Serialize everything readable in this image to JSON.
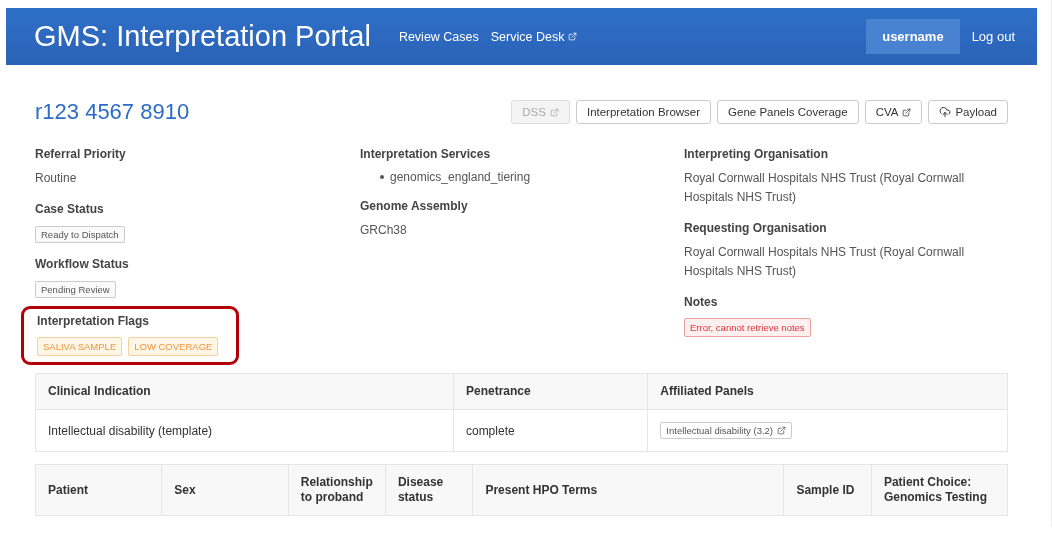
{
  "header": {
    "title": "GMS: Interpretation Portal",
    "nav": [
      {
        "label": "Review Cases",
        "external": false
      },
      {
        "label": "Service Desk",
        "external": true
      }
    ],
    "user": "username",
    "logout": "Log out"
  },
  "case": {
    "id": "r123 4567 8910",
    "actions": [
      {
        "label": "DSS",
        "external": true,
        "disabled": true,
        "kind": "link"
      },
      {
        "label": "Interpretation Browser",
        "external": false,
        "disabled": false,
        "kind": "link"
      },
      {
        "label": "Gene Panels Coverage",
        "external": false,
        "disabled": false,
        "kind": "link"
      },
      {
        "label": "CVA",
        "external": true,
        "disabled": false,
        "kind": "link"
      },
      {
        "label": "Payload",
        "external": false,
        "disabled": false,
        "kind": "upload"
      }
    ]
  },
  "details": [
    [
      {
        "label": "Referral Priority",
        "kind": "text",
        "value": "Routine"
      },
      {
        "label": "Case Status",
        "kind": "tag",
        "value": "Ready to Dispatch"
      },
      {
        "label": "Workflow Status",
        "kind": "tag",
        "value": "Pending Review"
      },
      {
        "label": "Interpretation Flags",
        "kind": "flags",
        "highlighted": true,
        "values": [
          "SALIVA SAMPLE",
          "LOW COVERAGE"
        ]
      }
    ],
    [
      {
        "label": "Interpretation Services",
        "kind": "list",
        "values": [
          "genomics_england_tiering"
        ]
      },
      {
        "label": "Genome Assembly",
        "kind": "text",
        "value": "GRCh38"
      }
    ],
    [
      {
        "label": "Interpreting Organisation",
        "kind": "text",
        "value": "Royal Cornwall Hospitals NHS Trust (Royal Cornwall Hospitals NHS Trust)"
      },
      {
        "label": "Requesting Organisation",
        "kind": "text",
        "value": "Royal Cornwall Hospitals NHS Trust (Royal Cornwall Hospitals NHS Trust)"
      },
      {
        "label": "Notes",
        "kind": "error",
        "value": "Error, cannot retrieve notes"
      }
    ]
  ],
  "indication_table": {
    "columns": [
      "Clinical Indication",
      "Penetrance",
      "Affiliated Panels"
    ],
    "rows": [
      [
        "Intellectual disability (template)",
        "complete",
        "Intellectual disability (3.2)"
      ]
    ]
  },
  "participants_table": {
    "columns": [
      "Patient",
      "Sex",
      "Relationship to proband",
      "Disease status",
      "Present HPO Terms",
      "Sample ID",
      "Patient Choice: Genomics Testing"
    ]
  }
}
